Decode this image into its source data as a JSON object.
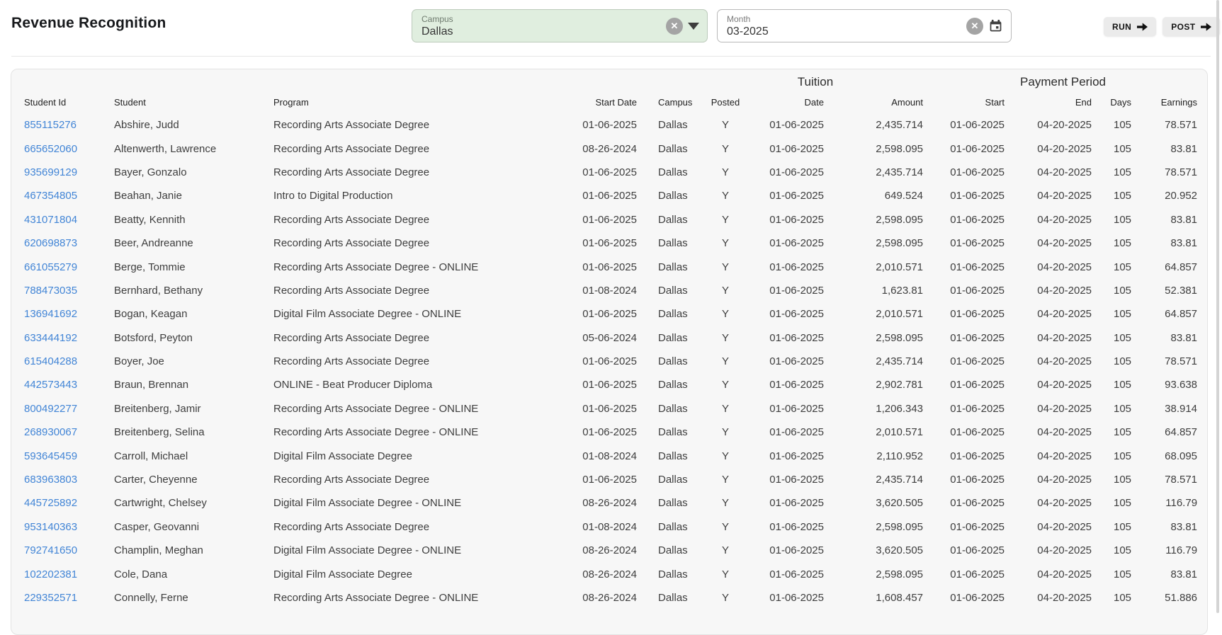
{
  "page": {
    "title": "Revenue Recognition"
  },
  "filters": {
    "campus": {
      "label": "Campus",
      "value": "Dallas"
    },
    "month": {
      "label": "Month",
      "value": "03-2025"
    }
  },
  "actions": {
    "run": "RUN",
    "post": "POST"
  },
  "icons": {
    "clear_glyph": "✕",
    "campus_clear": "clear-icon",
    "campus_dropdown": "chevron-down-icon",
    "month_clear": "clear-icon",
    "month_calendar": "calendar-icon",
    "run_arrow": "arrow-right-icon",
    "post_arrow": "arrow-right-icon"
  },
  "colors": {
    "campus_field_bg": "#e0eedf",
    "campus_field_border": "#bccabb",
    "link_blue": "#4285d6",
    "card_bg": "#f7f7f7",
    "button_bg": "#ebebeb"
  },
  "table": {
    "group_headers": [
      {
        "label": "Tuition"
      },
      {
        "label": "Payment Period"
      }
    ],
    "columns": [
      {
        "label": "Student Id"
      },
      {
        "label": "Student"
      },
      {
        "label": "Program"
      },
      {
        "label": "Start Date"
      },
      {
        "label": "Campus"
      },
      {
        "label": "Posted"
      },
      {
        "label": "Date"
      },
      {
        "label": "Amount"
      },
      {
        "label": "Start"
      },
      {
        "label": "End"
      },
      {
        "label": "Days"
      },
      {
        "label": "Earnings"
      }
    ],
    "rows": [
      [
        "855115276",
        "Abshire, Judd",
        "Recording Arts Associate Degree",
        "01-06-2025",
        "Dallas",
        "Y",
        "01-06-2025",
        "2,435.714",
        "01-06-2025",
        "04-20-2025",
        "105",
        "78.571"
      ],
      [
        "665652060",
        "Altenwerth, Lawrence",
        "Recording Arts Associate Degree",
        "08-26-2024",
        "Dallas",
        "Y",
        "01-06-2025",
        "2,598.095",
        "01-06-2025",
        "04-20-2025",
        "105",
        "83.81"
      ],
      [
        "935699129",
        "Bayer, Gonzalo",
        "Recording Arts Associate Degree",
        "01-06-2025",
        "Dallas",
        "Y",
        "01-06-2025",
        "2,435.714",
        "01-06-2025",
        "04-20-2025",
        "105",
        "78.571"
      ],
      [
        "467354805",
        "Beahan, Janie",
        "Intro to Digital Production",
        "01-06-2025",
        "Dallas",
        "Y",
        "01-06-2025",
        "649.524",
        "01-06-2025",
        "04-20-2025",
        "105",
        "20.952"
      ],
      [
        "431071804",
        "Beatty, Kennith",
        "Recording Arts Associate Degree",
        "01-06-2025",
        "Dallas",
        "Y",
        "01-06-2025",
        "2,598.095",
        "01-06-2025",
        "04-20-2025",
        "105",
        "83.81"
      ],
      [
        "620698873",
        "Beer, Andreanne",
        "Recording Arts Associate Degree",
        "01-06-2025",
        "Dallas",
        "Y",
        "01-06-2025",
        "2,598.095",
        "01-06-2025",
        "04-20-2025",
        "105",
        "83.81"
      ],
      [
        "661055279",
        "Berge, Tommie",
        "Recording Arts Associate Degree - ONLINE",
        "01-06-2025",
        "Dallas",
        "Y",
        "01-06-2025",
        "2,010.571",
        "01-06-2025",
        "04-20-2025",
        "105",
        "64.857"
      ],
      [
        "788473035",
        "Bernhard, Bethany",
        "Recording Arts Associate Degree",
        "01-08-2024",
        "Dallas",
        "Y",
        "01-06-2025",
        "1,623.81",
        "01-06-2025",
        "04-20-2025",
        "105",
        "52.381"
      ],
      [
        "136941692",
        "Bogan, Keagan",
        "Digital Film Associate Degree - ONLINE",
        "01-06-2025",
        "Dallas",
        "Y",
        "01-06-2025",
        "2,010.571",
        "01-06-2025",
        "04-20-2025",
        "105",
        "64.857"
      ],
      [
        "633444192",
        "Botsford, Peyton",
        "Recording Arts Associate Degree",
        "05-06-2024",
        "Dallas",
        "Y",
        "01-06-2025",
        "2,598.095",
        "01-06-2025",
        "04-20-2025",
        "105",
        "83.81"
      ],
      [
        "615404288",
        "Boyer, Joe",
        "Recording Arts Associate Degree",
        "01-06-2025",
        "Dallas",
        "Y",
        "01-06-2025",
        "2,435.714",
        "01-06-2025",
        "04-20-2025",
        "105",
        "78.571"
      ],
      [
        "442573443",
        "Braun, Brennan",
        "ONLINE - Beat Producer Diploma",
        "01-06-2025",
        "Dallas",
        "Y",
        "01-06-2025",
        "2,902.781",
        "01-06-2025",
        "04-20-2025",
        "105",
        "93.638"
      ],
      [
        "800492277",
        "Breitenberg, Jamir",
        "Recording Arts Associate Degree - ONLINE",
        "01-06-2025",
        "Dallas",
        "Y",
        "01-06-2025",
        "1,206.343",
        "01-06-2025",
        "04-20-2025",
        "105",
        "38.914"
      ],
      [
        "268930067",
        "Breitenberg, Selina",
        "Recording Arts Associate Degree - ONLINE",
        "01-06-2025",
        "Dallas",
        "Y",
        "01-06-2025",
        "2,010.571",
        "01-06-2025",
        "04-20-2025",
        "105",
        "64.857"
      ],
      [
        "593645459",
        "Carroll, Michael",
        "Digital Film Associate Degree",
        "01-08-2024",
        "Dallas",
        "Y",
        "01-06-2025",
        "2,110.952",
        "01-06-2025",
        "04-20-2025",
        "105",
        "68.095"
      ],
      [
        "683963803",
        "Carter, Cheyenne",
        "Recording Arts Associate Degree",
        "01-06-2025",
        "Dallas",
        "Y",
        "01-06-2025",
        "2,435.714",
        "01-06-2025",
        "04-20-2025",
        "105",
        "78.571"
      ],
      [
        "445725892",
        "Cartwright, Chelsey",
        "Digital Film Associate Degree - ONLINE",
        "08-26-2024",
        "Dallas",
        "Y",
        "01-06-2025",
        "3,620.505",
        "01-06-2025",
        "04-20-2025",
        "105",
        "116.79"
      ],
      [
        "953140363",
        "Casper, Geovanni",
        "Recording Arts Associate Degree",
        "01-08-2024",
        "Dallas",
        "Y",
        "01-06-2025",
        "2,598.095",
        "01-06-2025",
        "04-20-2025",
        "105",
        "83.81"
      ],
      [
        "792741650",
        "Champlin, Meghan",
        "Digital Film Associate Degree - ONLINE",
        "08-26-2024",
        "Dallas",
        "Y",
        "01-06-2025",
        "3,620.505",
        "01-06-2025",
        "04-20-2025",
        "105",
        "116.79"
      ],
      [
        "102202381",
        "Cole, Dana",
        "Digital Film Associate Degree",
        "08-26-2024",
        "Dallas",
        "Y",
        "01-06-2025",
        "2,598.095",
        "01-06-2025",
        "04-20-2025",
        "105",
        "83.81"
      ],
      [
        "229352571",
        "Connelly, Ferne",
        "Recording Arts Associate Degree - ONLINE",
        "08-26-2024",
        "Dallas",
        "Y",
        "01-06-2025",
        "1,608.457",
        "01-06-2025",
        "04-20-2025",
        "105",
        "51.886"
      ]
    ]
  }
}
